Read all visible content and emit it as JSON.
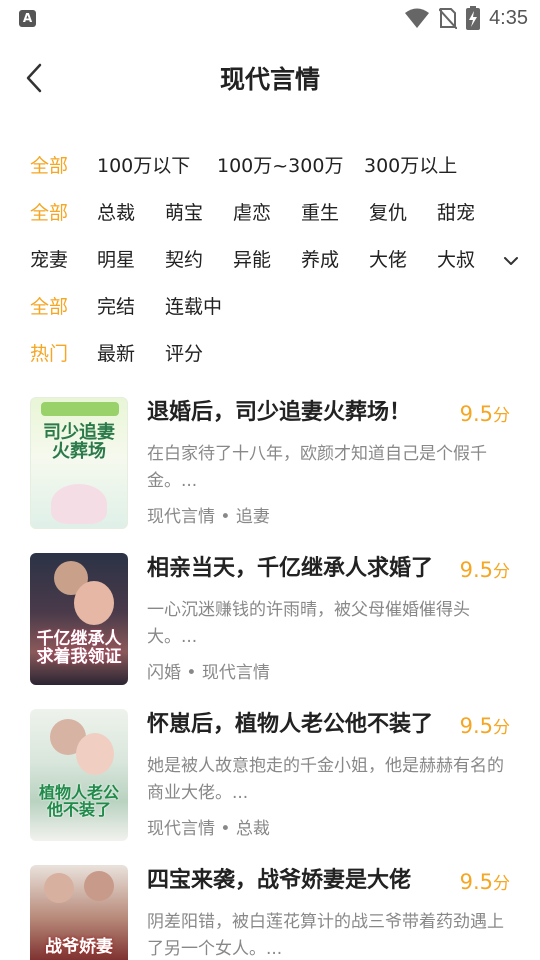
{
  "status_bar": {
    "app_icon_letter": "A",
    "time": "4:35",
    "icons": [
      "wifi-icon",
      "no-sim-icon",
      "battery-charging-icon"
    ]
  },
  "header": {
    "back_icon": "back-arrow-icon",
    "title": "现代言情"
  },
  "filters": {
    "words": [
      "全部",
      "100万以下",
      "100万~300万",
      "300万以上"
    ],
    "categories_row1": [
      "全部",
      "总裁",
      "萌宝",
      "虐恋",
      "重生",
      "复仇",
      "甜宠"
    ],
    "categories_row2": [
      "宠妻",
      "明星",
      "契约",
      "异能",
      "养成",
      "大佬",
      "大叔"
    ],
    "status": [
      "全部",
      "完结",
      "连载中"
    ],
    "sort": [
      "热门",
      "最新",
      "评分"
    ],
    "expand_icon": "chevron-down-icon",
    "active_color": "#f5a623"
  },
  "books": [
    {
      "title": "退婚后，司少追妻火葬场！",
      "score": "9.5",
      "score_unit": "分",
      "description": "在白家待了十八年，欧颜才知道自己是个假千金。...",
      "tags": "现代言情 • 追妻",
      "cover_text": "司少追妻火葬场"
    },
    {
      "title": "相亲当天，千亿继承人求婚了",
      "score": "9.5",
      "score_unit": "分",
      "description": "一心沉迷赚钱的许雨晴，被父母催婚催得头大。...",
      "tags": "闪婚 • 现代言情",
      "cover_text": "千亿继承人求着我领证"
    },
    {
      "title": "怀崽后，植物人老公他不装了",
      "score": "9.5",
      "score_unit": "分",
      "description": "她是被人故意抱走的千金小姐，他是赫赫有名的商业大佬。...",
      "tags": "现代言情 • 总裁",
      "cover_text": "植物人老公他不装了"
    },
    {
      "title": "四宝来袭，战爷娇妻是大佬",
      "score": "9.5",
      "score_unit": "分",
      "description": "阴差阳错，被白莲花算计的战三爷带着药劲遇上了另一个女人。...",
      "tags": "",
      "cover_text": "战爷娇妻"
    }
  ]
}
